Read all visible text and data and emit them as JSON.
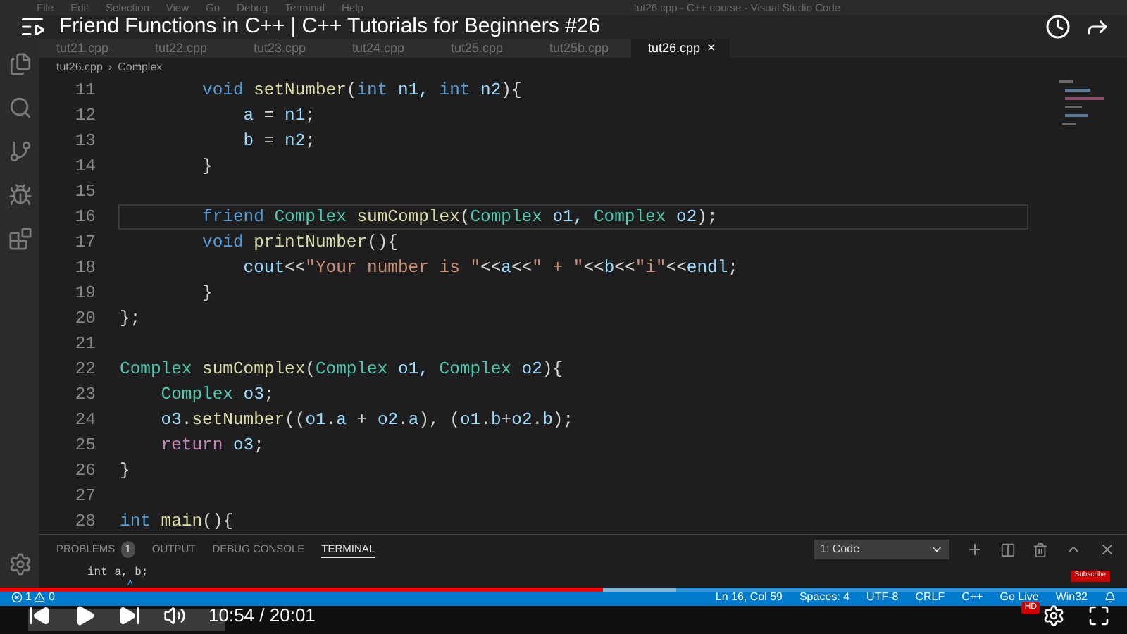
{
  "video_title": "Friend Functions in C++ | C++ Tutorials for Beginners #26",
  "menu": [
    "File",
    "Edit",
    "Selection",
    "View",
    "Go",
    "Debug",
    "Terminal",
    "Help"
  ],
  "window_title": "tut26.cpp - C++ course - Visual Studio Code",
  "tabs": [
    {
      "label": "tut21.cpp",
      "selected": false
    },
    {
      "label": "tut22.cpp",
      "selected": false
    },
    {
      "label": "tut23.cpp",
      "selected": false
    },
    {
      "label": "tut24.cpp",
      "selected": false
    },
    {
      "label": "tut25.cpp",
      "selected": false
    },
    {
      "label": "tut25b.cpp",
      "selected": false
    },
    {
      "label": "tut26.cpp",
      "selected": true
    }
  ],
  "tab_close": "×",
  "breadcrumb": [
    "tut26.cpp",
    "Complex"
  ],
  "breadcrumb_separator": "›",
  "code_lines": [
    {
      "number": "11",
      "current": false,
      "tokens": [
        {
          "text": "        void",
          "kind": "kw"
        },
        {
          "text": " setNumber",
          "kind": "fn"
        },
        {
          "text": "(",
          "kind": "plain"
        },
        {
          "text": "int",
          "kind": "kw"
        },
        {
          "text": " n1, ",
          "kind": "var"
        },
        {
          "text": "int",
          "kind": "kw"
        },
        {
          "text": " n2",
          "kind": "var"
        },
        {
          "text": "){",
          "kind": "plain"
        }
      ]
    },
    {
      "number": "12",
      "current": false,
      "tokens": [
        {
          "text": "            a",
          "kind": "var"
        },
        {
          "text": " = ",
          "kind": "plain"
        },
        {
          "text": "n1",
          "kind": "var"
        },
        {
          "text": ";",
          "kind": "plain"
        }
      ]
    },
    {
      "number": "13",
      "current": false,
      "tokens": [
        {
          "text": "            b",
          "kind": "var"
        },
        {
          "text": " = ",
          "kind": "plain"
        },
        {
          "text": "n2",
          "kind": "var"
        },
        {
          "text": ";",
          "kind": "plain"
        }
      ]
    },
    {
      "number": "14",
      "current": false,
      "tokens": [
        {
          "text": "        }",
          "kind": "plain"
        }
      ]
    },
    {
      "number": "15",
      "current": false
    },
    {
      "number": "16",
      "current": true,
      "tokens": [
        {
          "text": "        friend",
          "kind": "kw"
        },
        {
          "text": " Complex",
          "kind": "type"
        },
        {
          "text": " sumComplex",
          "kind": "fn"
        },
        {
          "text": "(",
          "kind": "plain"
        },
        {
          "text": "Complex",
          "kind": "type"
        },
        {
          "text": " o1, ",
          "kind": "var"
        },
        {
          "text": "Complex",
          "kind": "type"
        },
        {
          "text": " o2",
          "kind": "var"
        },
        {
          "text": ");",
          "kind": "plain"
        }
      ]
    },
    {
      "number": "17",
      "current": false,
      "tokens": [
        {
          "text": "        void",
          "kind": "kw"
        },
        {
          "text": " printNumber",
          "kind": "fn"
        },
        {
          "text": "(){",
          "kind": "plain"
        }
      ]
    },
    {
      "number": "18",
      "current": false,
      "tokens": [
        {
          "text": "            cout",
          "kind": "var"
        },
        {
          "text": "<<",
          "kind": "plain"
        },
        {
          "text": "\"Your number is \"",
          "kind": "str"
        },
        {
          "text": "<<",
          "kind": "plain"
        },
        {
          "text": "a",
          "kind": "var"
        },
        {
          "text": "<<",
          "kind": "plain"
        },
        {
          "text": "\" + \"",
          "kind": "str"
        },
        {
          "text": "<<",
          "kind": "plain"
        },
        {
          "text": "b",
          "kind": "var"
        },
        {
          "text": "<<",
          "kind": "plain"
        },
        {
          "text": "\"i\"",
          "kind": "str"
        },
        {
          "text": "<<",
          "kind": "plain"
        },
        {
          "text": "endl",
          "kind": "var"
        },
        {
          "text": ";",
          "kind": "plain"
        }
      ]
    },
    {
      "number": "19",
      "current": false,
      "tokens": [
        {
          "text": "        }",
          "kind": "plain"
        }
      ]
    },
    {
      "number": "20",
      "current": false,
      "tokens": [
        {
          "text": "};",
          "kind": "plain"
        }
      ]
    },
    {
      "number": "21",
      "current": false
    },
    {
      "number": "22",
      "current": false,
      "tokens": [
        {
          "text": "Complex",
          "kind": "type"
        },
        {
          "text": " sumComplex",
          "kind": "fn"
        },
        {
          "text": "(",
          "kind": "plain"
        },
        {
          "text": "Complex",
          "kind": "type"
        },
        {
          "text": " o1, ",
          "kind": "var"
        },
        {
          "text": "Complex",
          "kind": "type"
        },
        {
          "text": " o2",
          "kind": "var"
        },
        {
          "text": "){",
          "kind": "plain"
        }
      ]
    },
    {
      "number": "23",
      "current": false,
      "tokens": [
        {
          "text": "    Complex",
          "kind": "type"
        },
        {
          "text": " o3",
          "kind": "var"
        },
        {
          "text": ";",
          "kind": "plain"
        }
      ]
    },
    {
      "number": "24",
      "current": false,
      "tokens": [
        {
          "text": "    o3",
          "kind": "var"
        },
        {
          "text": ".",
          "kind": "plain"
        },
        {
          "text": "setNumber",
          "kind": "fn"
        },
        {
          "text": "((",
          "kind": "plain"
        },
        {
          "text": "o1",
          "kind": "var"
        },
        {
          "text": ".",
          "kind": "plain"
        },
        {
          "text": "a",
          "kind": "var"
        },
        {
          "text": " + ",
          "kind": "plain"
        },
        {
          "text": "o2",
          "kind": "var"
        },
        {
          "text": ".",
          "kind": "plain"
        },
        {
          "text": "a",
          "kind": "var"
        },
        {
          "text": "), (",
          "kind": "plain"
        },
        {
          "text": "o1",
          "kind": "var"
        },
        {
          "text": ".",
          "kind": "plain"
        },
        {
          "text": "b",
          "kind": "var"
        },
        {
          "text": "+",
          "kind": "plain"
        },
        {
          "text": "o2",
          "kind": "var"
        },
        {
          "text": ".",
          "kind": "plain"
        },
        {
          "text": "b",
          "kind": "var"
        },
        {
          "text": ");",
          "kind": "plain"
        }
      ]
    },
    {
      "number": "25",
      "current": false,
      "tokens": [
        {
          "text": "    return",
          "kind": "ctl"
        },
        {
          "text": " o3",
          "kind": "var"
        },
        {
          "text": ";",
          "kind": "plain"
        }
      ]
    },
    {
      "number": "26",
      "current": false,
      "tokens": [
        {
          "text": "}",
          "kind": "plain"
        }
      ]
    },
    {
      "number": "27",
      "current": false
    },
    {
      "number": "28",
      "current": false,
      "tokens": [
        {
          "text": "int",
          "kind": "kw"
        },
        {
          "text": " main",
          "kind": "fn"
        },
        {
          "text": "(){",
          "kind": "plain"
        }
      ]
    }
  ],
  "panel_tabs": [
    {
      "label": "PROBLEMS",
      "badge": "1",
      "selected": false
    },
    {
      "label": "OUTPUT",
      "selected": false
    },
    {
      "label": "DEBUG CONSOLE",
      "selected": false
    },
    {
      "label": "TERMINAL",
      "selected": true
    }
  ],
  "terminal_select": "1: Code",
  "terminal_lines": [
    "int a, b;",
    "^"
  ],
  "status_left": {
    "errors": "1",
    "warnings": "0"
  },
  "status_right": [
    "Ln 16, Col 59",
    "Spaces: 4",
    "UTF-8",
    "CRLF",
    "C++",
    "Go Live",
    "Win32"
  ],
  "player": {
    "time": "10:54 / 20:01",
    "level": 0.535
  },
  "subscribe": "Subscribe",
  "hd_badge": "HD"
}
